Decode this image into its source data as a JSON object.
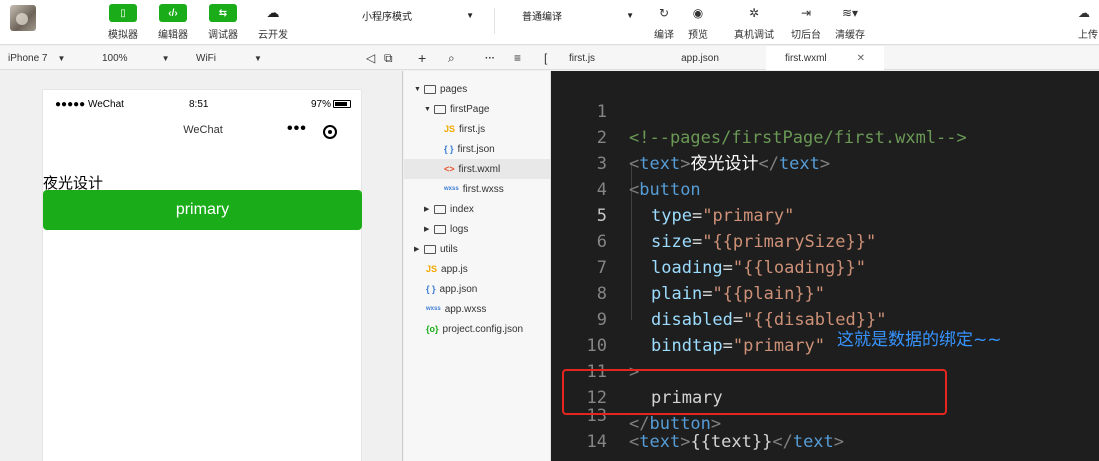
{
  "toolbar": {
    "simulator_label": "模拟器",
    "editor_label": "编辑器",
    "debugger_label": "调试器",
    "cloud_label": "云开发",
    "mode_select": "小程序模式",
    "compile_select": "普通编译",
    "compile_label": "编译",
    "preview_label": "预览",
    "device_debug_label": "真机调试",
    "background_label": "切后台",
    "clear_cache_label": "清缓存",
    "upload_label": "上传"
  },
  "device_bar": {
    "device": "iPhone 7",
    "zoom": "100%",
    "network": "WiFi"
  },
  "tabs": [
    {
      "label": "first.js"
    },
    {
      "label": "app.json"
    },
    {
      "label": "first.wxml"
    }
  ],
  "simulator": {
    "carrier": "●●●●● WeChat",
    "time": "8:51",
    "battery": "97%",
    "nav_title": "WeChat",
    "page_text": "夜光设计",
    "button_label": "primary"
  },
  "file_tree": [
    {
      "label": "pages"
    },
    {
      "label": "firstPage"
    },
    {
      "label": "first.js"
    },
    {
      "label": "first.json"
    },
    {
      "label": "first.wxml"
    },
    {
      "label": "first.wxss"
    },
    {
      "label": "index"
    },
    {
      "label": "logs"
    },
    {
      "label": "utils"
    },
    {
      "label": "app.js"
    },
    {
      "label": "app.json"
    },
    {
      "label": "app.wxss"
    },
    {
      "label": "project.config.json"
    }
  ],
  "editor": {
    "line_numbers": [
      "1",
      "2",
      "3",
      "4",
      "5",
      "6",
      "7",
      "8",
      "9",
      "10",
      "11",
      "12",
      "13",
      "14"
    ],
    "line1_comment": "<!--pages/firstPage/first.wxml-->",
    "tag_text": "text",
    "tag_button": "button",
    "line2_content": "夜光设计",
    "attr_type": "type",
    "val_type": "\"primary\"",
    "attr_size": "size",
    "val_size": "\"{{primarySize}}\"",
    "attr_loading": "loading",
    "val_loading": "\"{{loading}}\"",
    "attr_plain": "plain",
    "val_plain": "\"{{plain}}\"",
    "attr_disabled": "disabled",
    "val_disabled": "\"{{disabled}}\"",
    "attr_bindtap": "bindtap",
    "val_bindtap": "\"primary\"",
    "line11_content": "primary",
    "line13_content": "{{text}}",
    "annotation": "这就是数据的绑定~~"
  }
}
